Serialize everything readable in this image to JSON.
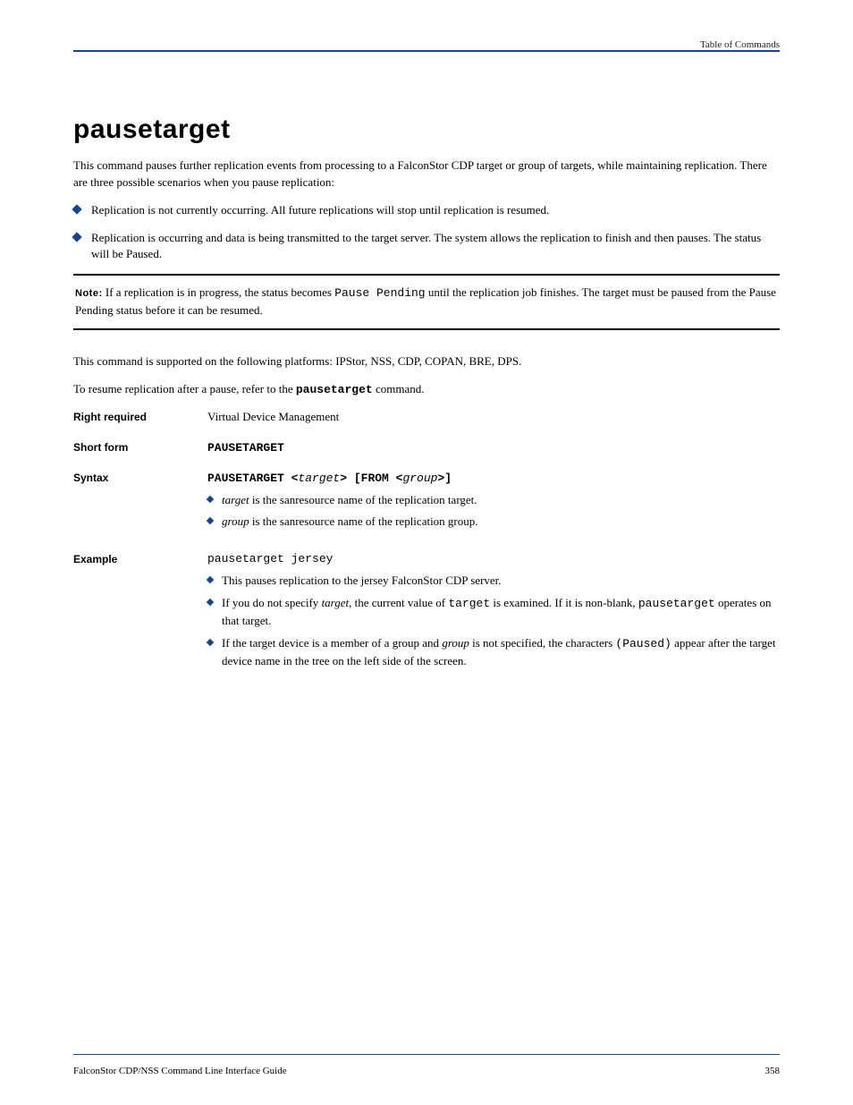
{
  "header": {
    "right": "Table of Commands"
  },
  "title": "pausetarget",
  "intro": "This command pauses further replication events from processing to a FalconStor CDP target or group of targets, while maintaining replication. There are three possible scenarios when you pause replication:",
  "bullets": [
    "Replication is not currently occurring. All future replications will stop until replication is resumed.",
    "Replication is occurring and data is being transmitted to the target server. The system allows the replication to finish and then pauses. The status will be Paused."
  ],
  "note": {
    "label": "Note:",
    "text_before": "If a replication is in progress, the status becomes ",
    "code": "Pause Pending",
    "text_after": " until the replication job finishes. The target must be paused from the Pause Pending status before it can be resumed."
  },
  "supports": {
    "lead": "This command is supported on the following platforms: ",
    "platforms": "IPStor, NSS, CDP, COPAN, BRE, DPS."
  },
  "tip": {
    "before": "To resume replication after a pause, refer to the ",
    "code": "pausetarget",
    "after": " command."
  },
  "defs": {
    "rights_label": "Right required",
    "rights_value": "Virtual Device Management",
    "shortform_label": "Short form",
    "shortform_value": "PAUSETARGET",
    "syntax_label": "Syntax",
    "syntax_tokens": {
      "cmd": "PAUSETARGET <",
      "arg1": "target",
      "mid": "> [FROM <",
      "arg2": "group",
      "end": ">]"
    },
    "syntax_bullets": [
      {
        "arg": "target",
        "text": " is the sanresource name of the replication target."
      },
      {
        "arg": "group",
        "text": " is the sanresource name of the replication group."
      }
    ],
    "example_label": "Example",
    "example_code": "pausetarget jersey",
    "example_bullets": [
      {
        "plain": "This pauses replication to the jersey FalconStor CDP server."
      },
      {
        "before": "If you do not specify ",
        "code1": "target",
        "mid": ", the current value of ",
        "code2": "target",
        "after1": " is examined. If it is non-blank, ",
        "code3": "pausetarget",
        "after2": " operates on that target."
      },
      {
        "before": "If the target device is a member of a group and ",
        "arg": "group",
        "mid": " is not specified, the characters ",
        "code": "(Paused)",
        "after": " appear after the target device name in the tree on the left side of the screen."
      }
    ]
  },
  "footer": {
    "left": "FalconStor CDP/NSS Command Line Interface Guide",
    "right": "358"
  }
}
